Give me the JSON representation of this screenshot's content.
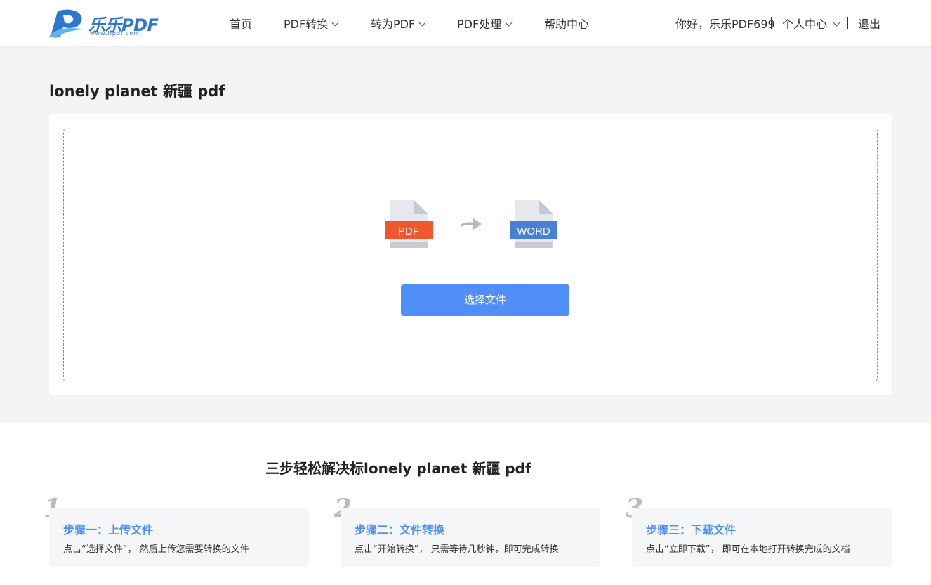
{
  "header": {
    "logo_text": "乐乐PDF",
    "logo_url_text": "www.llpdf.com",
    "nav": [
      {
        "label": "首页"
      },
      {
        "label": "PDF转换"
      },
      {
        "label": "转为PDF"
      },
      {
        "label": "PDF处理"
      },
      {
        "label": "帮助中心"
      }
    ],
    "greeting": "你好，乐乐PDF699",
    "user_center": "个人中心",
    "logout": "退出"
  },
  "main": {
    "title": "lonely planet 新疆 pdf",
    "from_format": "PDF",
    "to_format": "WORD",
    "select_button": "选择文件"
  },
  "steps": {
    "title": "三步轻松解决标lonely planet 新疆 pdf",
    "items": [
      {
        "num": "1",
        "title": "步骤一：上传文件",
        "desc": "点击“选择文件”， 然后上传您需要转换的文件"
      },
      {
        "num": "2",
        "title": "步骤二：文件转换",
        "desc": "点击“开始转换”， 只需等待几秒钟，即可完成转换"
      },
      {
        "num": "3",
        "title": "步骤三：下载文件",
        "desc": "点击“立即下载”， 即可在本地打开转换完成的文档"
      }
    ]
  },
  "colors": {
    "accent": "#4f8ff7",
    "pdf_badge": "#f0572a",
    "word_badge": "#4a7fd6"
  },
  "icons": [
    "logo-icon",
    "pdf-file-icon",
    "arrow-right-icon",
    "word-file-icon",
    "chevron-down-icon"
  ]
}
